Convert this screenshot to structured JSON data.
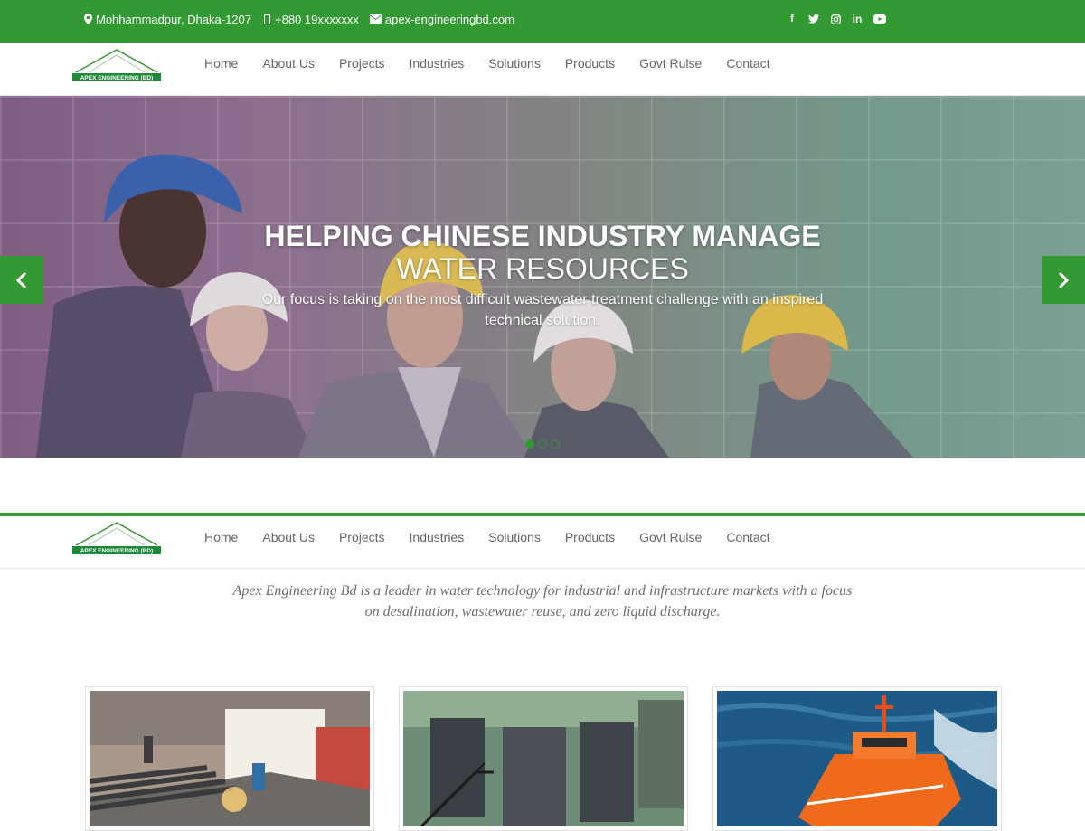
{
  "topbar": {
    "address": "Mohhammadpur, Dhaka-1207",
    "phone": "+880 19xxxxxxx",
    "email": "apex-engineeringbd.com",
    "social_icons": [
      "facebook-icon",
      "twitter-icon",
      "instagram-icon",
      "linkedin-icon",
      "youtube-icon"
    ]
  },
  "logo": {
    "text": "APEX ENGINEERING (BD)"
  },
  "nav": {
    "items": [
      {
        "label": "Home"
      },
      {
        "label": "About Us"
      },
      {
        "label": "Projects"
      },
      {
        "label": "Industries"
      },
      {
        "label": "Solutions"
      },
      {
        "label": "Products"
      },
      {
        "label": "Govt Rulse"
      },
      {
        "label": "Contact"
      }
    ]
  },
  "hero": {
    "title_line1": "HELPING CHINESE INDUSTRY MANAGE",
    "title_line2": "WATER RESOURCES",
    "subtitle": "Our focus is taking on the most difficult wastewater treatment challenge with an inspired technical solution.",
    "slides": 3,
    "active_slide": 1
  },
  "intro": {
    "text": "Apex Engineering Bd is a leader in water technology for industrial and infrastructure markets with a focus on desalination, wastewater reuse, and zero liquid discharge."
  },
  "colors": {
    "brand_green": "#339933",
    "text_gray": "#666666"
  }
}
